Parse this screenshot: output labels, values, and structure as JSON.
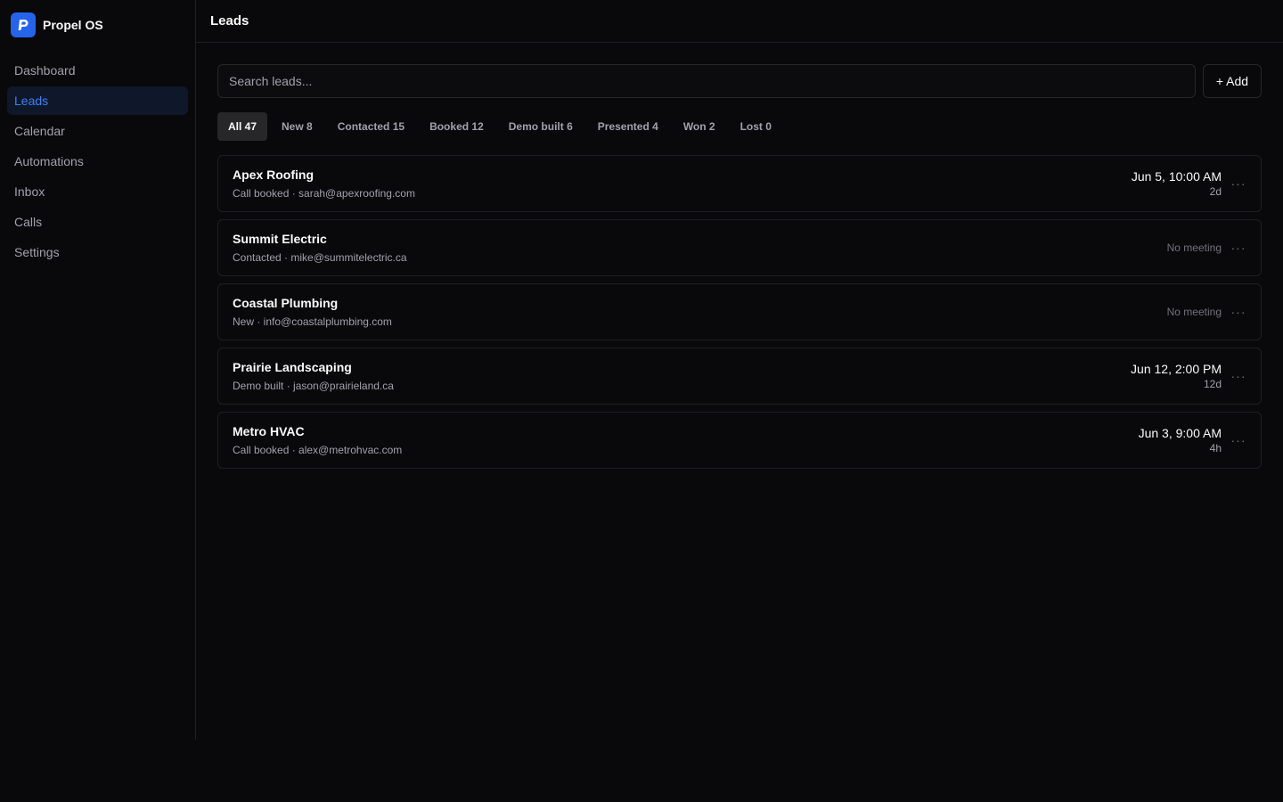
{
  "brand": {
    "name": "Propel OS",
    "logo_letter": "P",
    "accent": "#2563eb"
  },
  "sidebar": {
    "items": [
      {
        "label": "Dashboard",
        "active": false
      },
      {
        "label": "Leads",
        "active": true
      },
      {
        "label": "Calendar",
        "active": false
      },
      {
        "label": "Automations",
        "active": false
      },
      {
        "label": "Inbox",
        "active": false
      },
      {
        "label": "Calls",
        "active": false
      },
      {
        "label": "Settings",
        "active": false
      }
    ]
  },
  "header": {
    "title": "Leads"
  },
  "search": {
    "placeholder": "Search leads...",
    "value": ""
  },
  "toolbar": {
    "add_label": "+ Add"
  },
  "filters": [
    {
      "label": "All 47",
      "active": true
    },
    {
      "label": "New 8",
      "active": false
    },
    {
      "label": "Contacted 15",
      "active": false
    },
    {
      "label": "Booked 12",
      "active": false
    },
    {
      "label": "Demo built 6",
      "active": false
    },
    {
      "label": "Presented 4",
      "active": false
    },
    {
      "label": "Won 2",
      "active": false
    },
    {
      "label": "Lost 0",
      "active": false
    }
  ],
  "leads": [
    {
      "name": "Apex Roofing",
      "meta": "Call booked · sarah@apexroofing.com",
      "date": "Jun 5, 10:00 AM",
      "relative": "2d",
      "no_meeting": ""
    },
    {
      "name": "Summit Electric",
      "meta": "Contacted · mike@summitelectric.ca",
      "date": "",
      "relative": "",
      "no_meeting": "No meeting"
    },
    {
      "name": "Coastal Plumbing",
      "meta": "New · info@coastalplumbing.com",
      "date": "",
      "relative": "",
      "no_meeting": "No meeting"
    },
    {
      "name": "Prairie Landscaping",
      "meta": "Demo built · jason@prairieland.ca",
      "date": "Jun 12, 2:00 PM",
      "relative": "12d",
      "no_meeting": ""
    },
    {
      "name": "Metro HVAC",
      "meta": "Call booked · alex@metrohvac.com",
      "date": "Jun 3, 9:00 AM",
      "relative": "4h",
      "no_meeting": ""
    }
  ],
  "icons": {
    "more": "more-horizontal-icon"
  }
}
